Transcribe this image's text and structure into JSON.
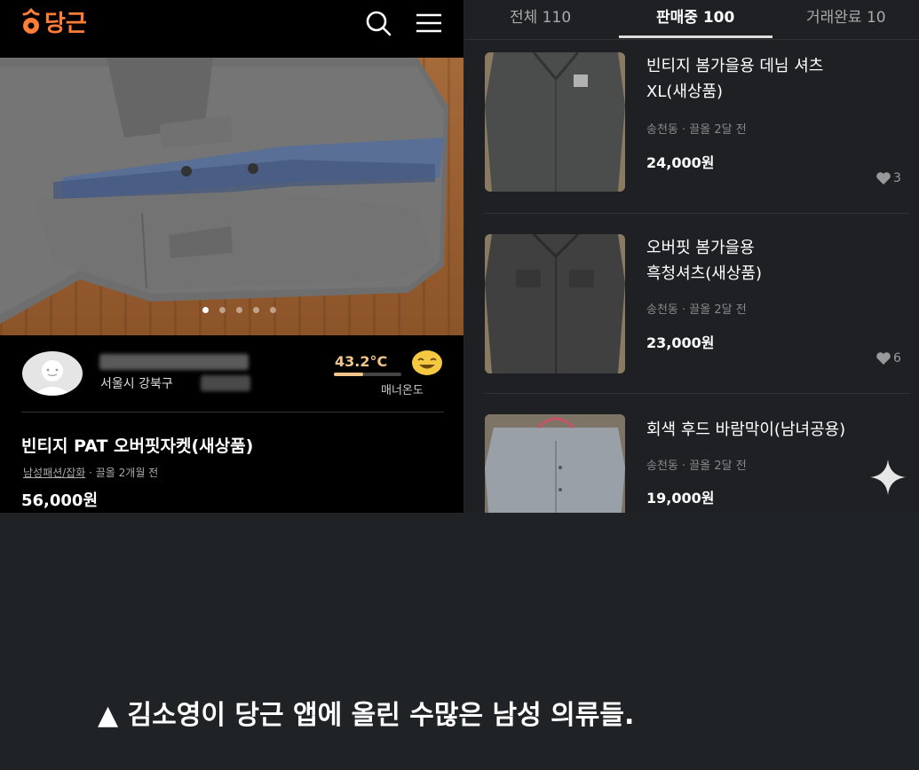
{
  "app": {
    "logo_text": "당근",
    "logo_icon": "carrot-icon"
  },
  "header_icons": [
    "search-icon",
    "menu-icon"
  ],
  "product": {
    "seller_location": "서울시 강북구",
    "manner_temp": "43.2°C",
    "manner_label": "매너온도",
    "manner_fraction": 0.43,
    "title": "빈티지 PAT 오버핏자켓(새상품)",
    "category": "남성패션/잡화",
    "time": "· 끌올 2개월 전",
    "price": "56,000원",
    "photo_count": 5,
    "photo_index": 1
  },
  "tabs": [
    {
      "label": "전체 110",
      "active": false
    },
    {
      "label": "판매중 100",
      "active": true
    },
    {
      "label": "거래완료 10",
      "active": false
    }
  ],
  "listings": [
    {
      "title_line1": "빈티지 봄가을용 데님 셔츠",
      "title_line2": "XL(새상품)",
      "meta": "송천동 · 끌올 2달 전",
      "price": "24,000원",
      "likes": "3"
    },
    {
      "title_line1": "오버핏 봄가을용",
      "title_line2": "흑청셔츠(새상품)",
      "meta": "송천동 · 끌올 2달 전",
      "price": "23,000원",
      "likes": "6"
    },
    {
      "title_line1": "회색 후드 바람막이(남녀공용)",
      "title_line2": "",
      "meta": "송천동 · 끌올 2달 전",
      "price": "19,000원",
      "likes": ""
    }
  ],
  "caption": "▲ 김소영이 당근 앱에 올린 수많은 남성 의류들.",
  "colors": {
    "brand": "#ff7e36",
    "temp": "#f2c58a",
    "left_bg": "#000000",
    "right_bg": "#1e2023",
    "page_bg": "#1f2325"
  }
}
